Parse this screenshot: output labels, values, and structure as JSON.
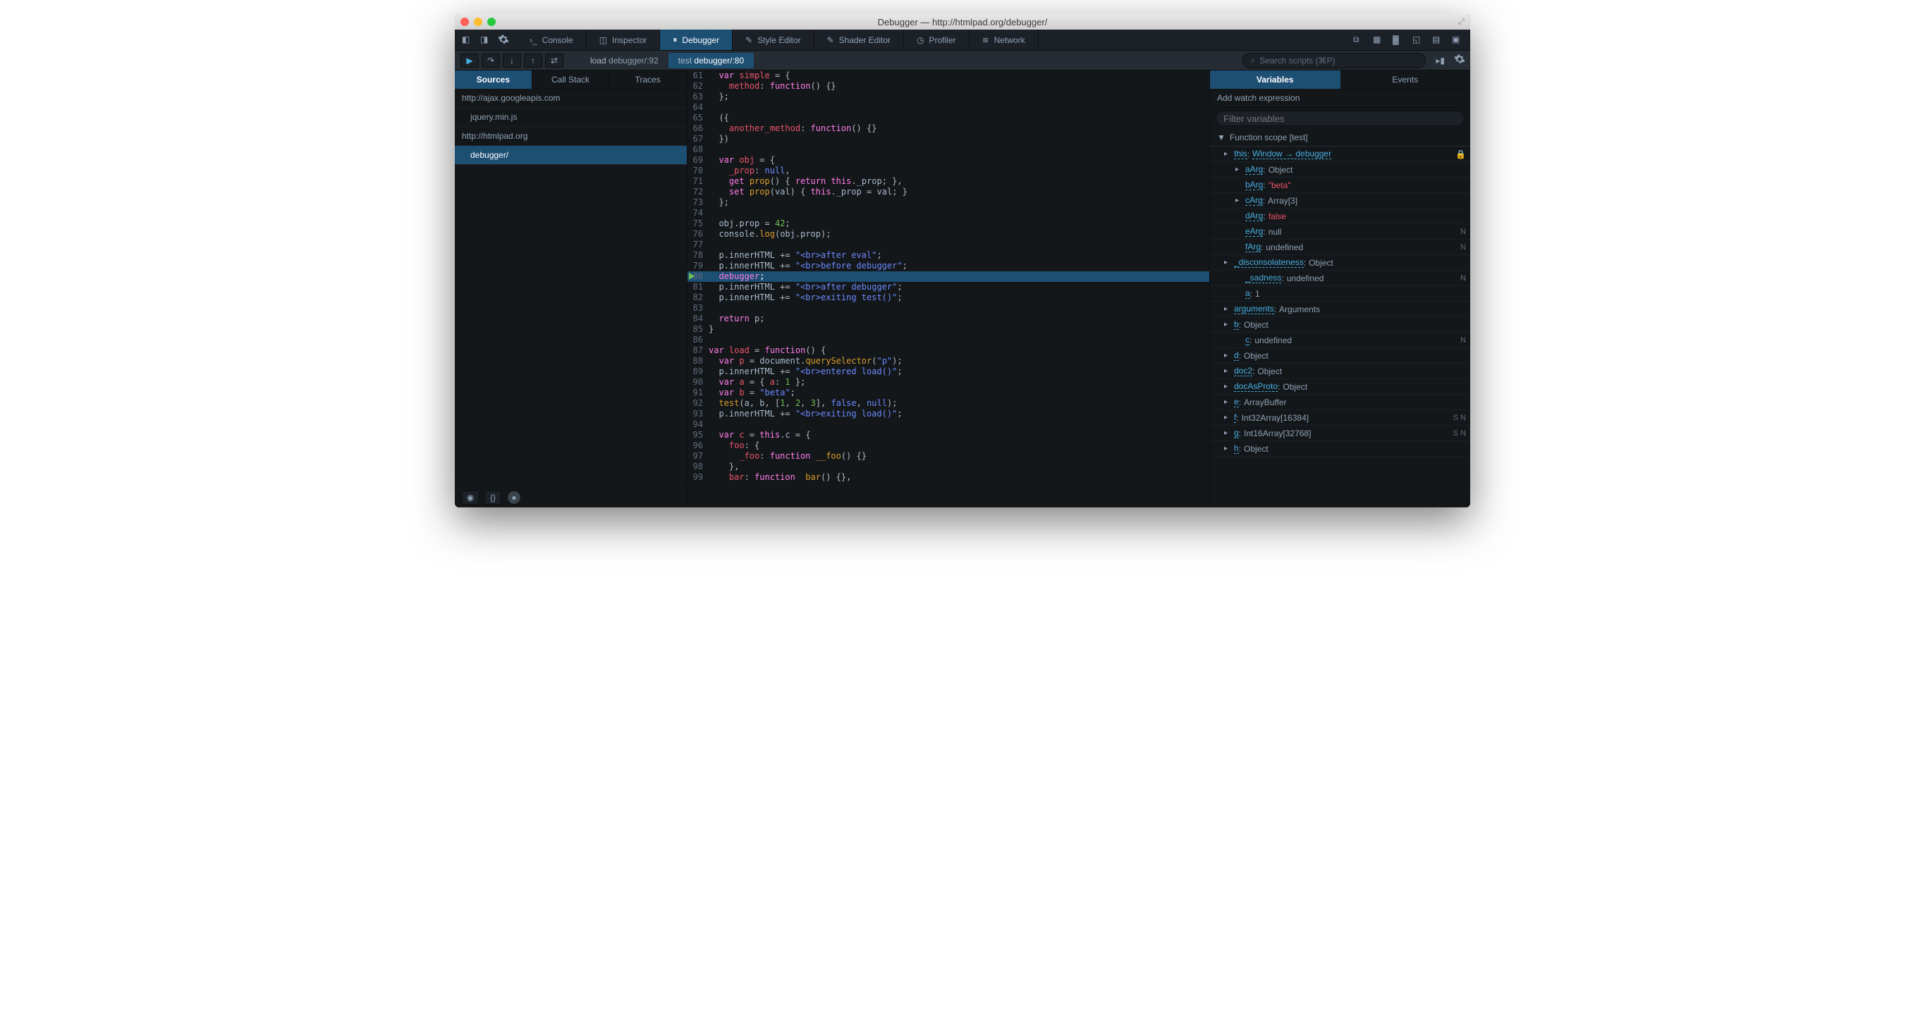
{
  "window": {
    "title": "Debugger — http://htmlpad.org/debugger/"
  },
  "toolbar": {
    "tabs": [
      {
        "label": "Console"
      },
      {
        "label": "Inspector"
      },
      {
        "label": "Debugger"
      },
      {
        "label": "Style Editor"
      },
      {
        "label": "Shader Editor"
      },
      {
        "label": "Profiler"
      },
      {
        "label": "Network"
      }
    ]
  },
  "controls": {
    "crumbs": [
      {
        "fn": "load",
        "loc": "debugger/:92"
      },
      {
        "fn": "test",
        "loc": "debugger/:80"
      }
    ],
    "search_placeholder": "Search scripts (⌘P)"
  },
  "left": {
    "tabs": [
      {
        "label": "Sources"
      },
      {
        "label": "Call Stack"
      },
      {
        "label": "Traces"
      }
    ],
    "sources": [
      {
        "label": "http://ajax.googleapis.com",
        "indent": false
      },
      {
        "label": "jquery.min.js",
        "indent": true
      },
      {
        "label": "http://htmlpad.org",
        "indent": false
      },
      {
        "label": "debugger/",
        "indent": true,
        "active": true
      }
    ]
  },
  "code": [
    {
      "n": 61,
      "html": "  <span class='k'>var</span> <span class='v'>simple</span> = {"
    },
    {
      "n": 62,
      "html": "    <span class='v'>method</span>: <span class='k'>function</span>() {}"
    },
    {
      "n": 63,
      "html": "  };"
    },
    {
      "n": 64,
      "html": ""
    },
    {
      "n": 65,
      "html": "  ({"
    },
    {
      "n": 66,
      "html": "    <span class='v'>another_method</span>: <span class='k'>function</span>() {}"
    },
    {
      "n": 67,
      "html": "  })"
    },
    {
      "n": 68,
      "html": ""
    },
    {
      "n": 69,
      "html": "  <span class='k'>var</span> <span class='v'>obj</span> = {"
    },
    {
      "n": 70,
      "html": "    <span class='v'>_prop</span>: <span class='str'>null</span>,"
    },
    {
      "n": 71,
      "html": "    <span class='k'>get</span> <span class='f'>prop</span>() { <span class='k'>return</span> <span class='k'>this</span>.<span class='p'>_prop</span>; },"
    },
    {
      "n": 72,
      "html": "    <span class='k'>set</span> <span class='f'>prop</span>(<span class='p'>val</span>) { <span class='k'>this</span>.<span class='p'>_prop</span> = <span class='p'>val</span>; }"
    },
    {
      "n": 73,
      "html": "  };"
    },
    {
      "n": 74,
      "html": ""
    },
    {
      "n": 75,
      "html": "  <span class='p'>obj</span>.<span class='p'>prop</span> = <span class='n'>42</span>;"
    },
    {
      "n": 76,
      "html": "  <span class='p'>console</span>.<span class='f'>log</span>(<span class='p'>obj</span>.<span class='p'>prop</span>);"
    },
    {
      "n": 77,
      "html": ""
    },
    {
      "n": 78,
      "html": "  <span class='p'>p</span>.<span class='p'>innerHTML</span> += <span class='str'>\"&lt;br&gt;after eval\"</span>;"
    },
    {
      "n": 79,
      "html": "  <span class='p'>p</span>.<span class='p'>innerHTML</span> += <span class='str'>\"&lt;br&gt;before debugger\"</span>;"
    },
    {
      "n": 80,
      "html": "  <span class='k'>debugger</span>;",
      "hl": true,
      "bp": true
    },
    {
      "n": 81,
      "html": "  <span class='p'>p</span>.<span class='p'>innerHTML</span> += <span class='str'>\"&lt;br&gt;after debugger\"</span>;"
    },
    {
      "n": 82,
      "html": "  <span class='p'>p</span>.<span class='p'>innerHTML</span> += <span class='str'>\"&lt;br&gt;exiting test()\"</span>;"
    },
    {
      "n": 83,
      "html": ""
    },
    {
      "n": 84,
      "html": "  <span class='k'>return</span> <span class='p'>p</span>;"
    },
    {
      "n": 85,
      "html": "}"
    },
    {
      "n": 86,
      "html": ""
    },
    {
      "n": 87,
      "html": "<span class='k'>var</span> <span class='v'>load</span> = <span class='k'>function</span>() {"
    },
    {
      "n": 88,
      "html": "  <span class='k'>var</span> <span class='v'>p</span> = <span class='p'>document</span>.<span class='f'>querySelector</span>(<span class='str'>\"p\"</span>);"
    },
    {
      "n": 89,
      "html": "  <span class='p'>p</span>.<span class='p'>innerHTML</span> += <span class='str'>\"&lt;br&gt;entered load()\"</span>;"
    },
    {
      "n": 90,
      "html": "  <span class='k'>var</span> <span class='v'>a</span> = { <span class='v'>a</span>: <span class='n'>1</span> };"
    },
    {
      "n": 91,
      "html": "  <span class='k'>var</span> <span class='v'>b</span> = <span class='str'>\"beta\"</span>;"
    },
    {
      "n": 92,
      "html": "  <span class='f'>test</span>(<span class='p'>a</span>, <span class='p'>b</span>, [<span class='n'>1</span>, <span class='n'>2</span>, <span class='n'>3</span>], <span class='str'>false</span>, <span class='str'>null</span>);"
    },
    {
      "n": 93,
      "html": "  <span class='p'>p</span>.<span class='p'>innerHTML</span> += <span class='str'>\"&lt;br&gt;exiting load()\"</span>;"
    },
    {
      "n": 94,
      "html": ""
    },
    {
      "n": 95,
      "html": "  <span class='k'>var</span> <span class='v'>c</span> = <span class='k'>this</span>.<span class='p'>c</span> = {"
    },
    {
      "n": 96,
      "html": "    <span class='v'>foo</span>: {"
    },
    {
      "n": 97,
      "html": "      <span class='v'>_foo</span>: <span class='k'>function</span> <span class='f'>__foo</span>() {}"
    },
    {
      "n": 98,
      "html": "    },"
    },
    {
      "n": 99,
      "html": "    <span class='v'>bar</span>: <span class='k'>function</span>  <span class='f'>bar</span>() {},"
    }
  ],
  "right": {
    "tabs": [
      {
        "label": "Variables"
      },
      {
        "label": "Events"
      }
    ],
    "watch_label": "Add watch expression",
    "filter_placeholder": "Filter variables",
    "scope": "Function scope [test]",
    "vars": [
      {
        "arrow": "▸",
        "name": "this",
        "val": "Window → debugger",
        "link": true,
        "lock": true
      },
      {
        "arrow": "▸",
        "name": "aArg",
        "val": "Object",
        "lvl": 1
      },
      {
        "arrow": "",
        "name": "bArg",
        "val": "\"beta\"",
        "red": true,
        "lvl": 1
      },
      {
        "arrow": "▸",
        "name": "cArg",
        "val": "Array[3]",
        "lvl": 1
      },
      {
        "arrow": "",
        "name": "dArg",
        "val": "false",
        "red": true,
        "lvl": 1
      },
      {
        "arrow": "",
        "name": "eArg",
        "val": "null",
        "badge": "N",
        "lvl": 1
      },
      {
        "arrow": "",
        "name": "fArg",
        "val": "undefined",
        "badge": "N",
        "lvl": 1
      },
      {
        "arrow": "▸",
        "name": "_disconsolateness",
        "val": "Object"
      },
      {
        "arrow": "",
        "name": "_sadness",
        "val": "undefined",
        "badge": "N",
        "lvl": 1
      },
      {
        "arrow": "",
        "name": "a",
        "val": "1",
        "lvl": 1
      },
      {
        "arrow": "▸",
        "name": "arguments",
        "val": "Arguments"
      },
      {
        "arrow": "▸",
        "name": "b",
        "val": "Object"
      },
      {
        "arrow": "",
        "name": "c",
        "val": "undefined",
        "badge": "N",
        "lvl": 1
      },
      {
        "arrow": "▸",
        "name": "d",
        "val": "Object"
      },
      {
        "arrow": "▸",
        "name": "doc2",
        "val": "Object"
      },
      {
        "arrow": "▸",
        "name": "docAsProto",
        "val": "Object"
      },
      {
        "arrow": "▸",
        "name": "e",
        "val": "ArrayBuffer"
      },
      {
        "arrow": "▸",
        "name": "f",
        "val": "Int32Array[16384]",
        "badge": "S N"
      },
      {
        "arrow": "▸",
        "name": "g",
        "val": "Int16Array[32768]",
        "badge": "S N"
      },
      {
        "arrow": "▸",
        "name": "h",
        "val": "Object"
      }
    ]
  }
}
